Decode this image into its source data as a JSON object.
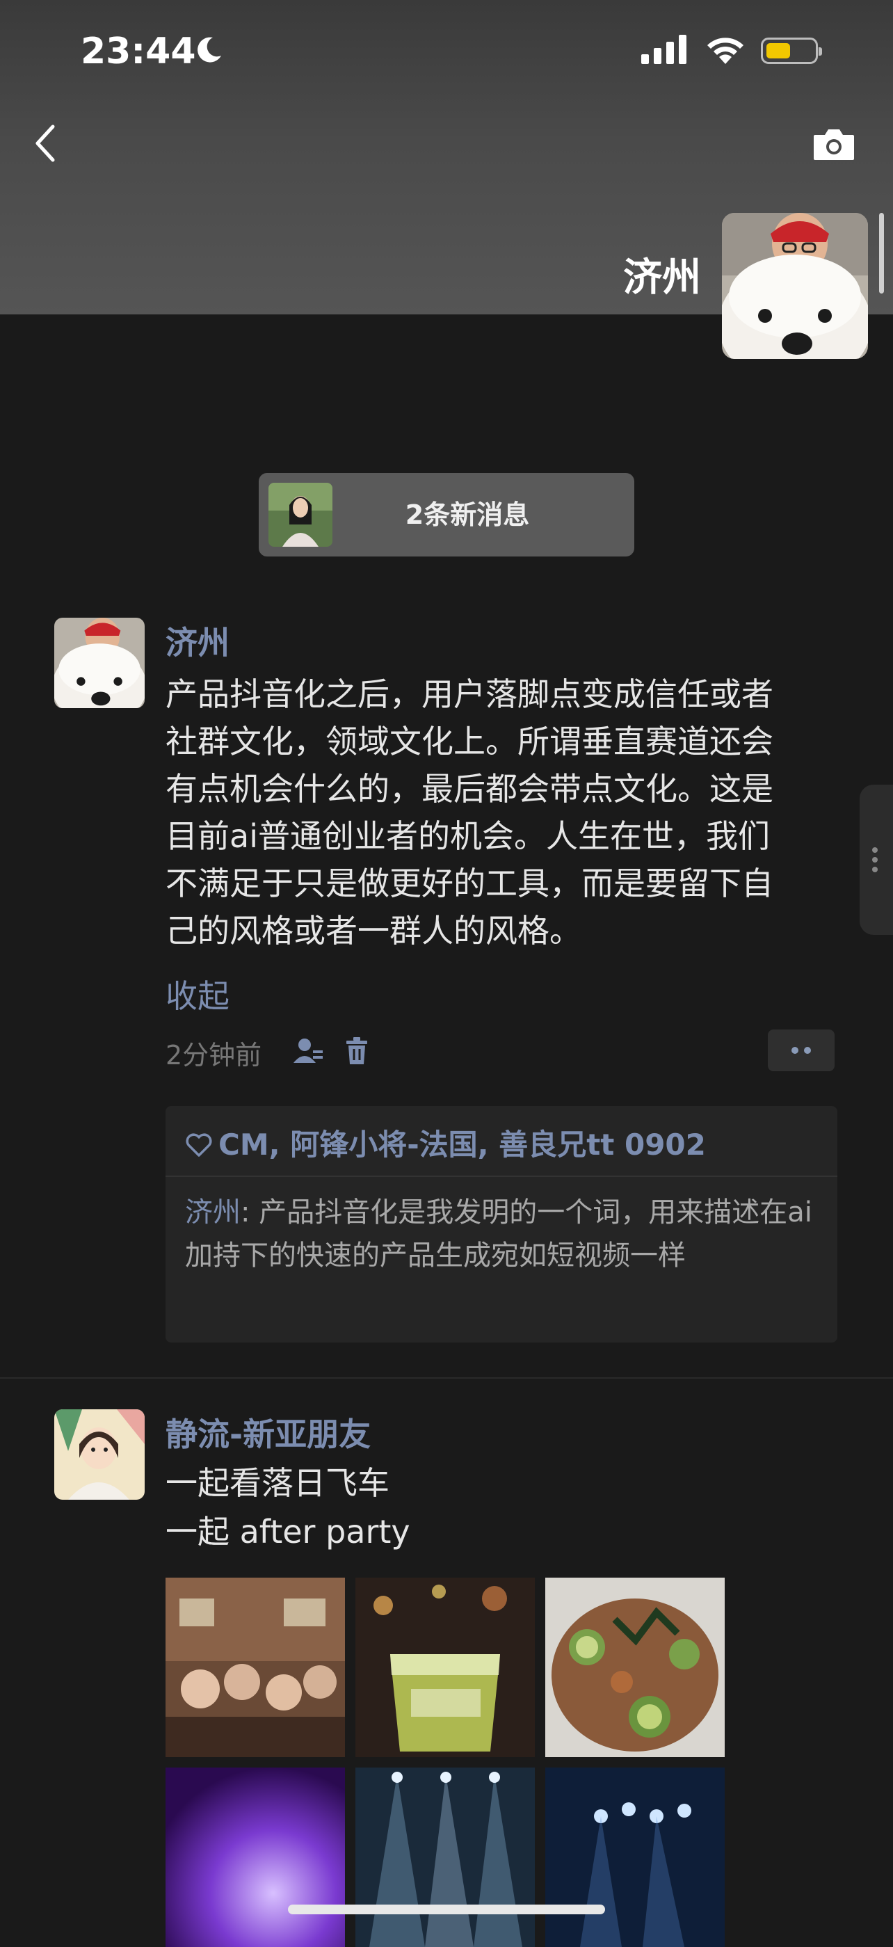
{
  "status": {
    "time": "23:44"
  },
  "cover": {
    "name": "济州"
  },
  "new_messages": {
    "label": "2条新消息"
  },
  "post1": {
    "author": "济州",
    "text": "产品抖音化之后，用户落脚点变成信任或者\n社群文化，领域文化上。所谓垂直赛道还会\n有点机会什么的，最后都会带点文化。这是\n目前ai普通创业者的机会。人生在世，我们\n不满足于只是做更好的工具，而是要留下自\n己的风格或者一群人的风格。",
    "collapse_label": "收起",
    "time_ago": "2分钟前",
    "likes": "CM, 阿锋小将-法国, 善良兄tt 0902",
    "comment_author": "济州",
    "comment_text": ": 产品抖音化是我发明的一个词，用来描述在ai加持下的快速的产品生成宛如短视频一样"
  },
  "post2": {
    "author": "静流-新亚朋友",
    "line1": "一起看落日飞车",
    "line2": "一起 after party"
  }
}
